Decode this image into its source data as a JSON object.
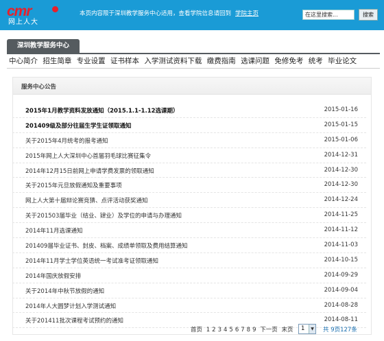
{
  "header": {
    "logo_mark": "cmr",
    "logo_sub": "网上人大",
    "notice": "本页内容限于深圳教学服务中心适用，查看学院信息请回到",
    "notice_link": "学院主页",
    "search_placeholder": "在这里搜索...",
    "search_button": "搜索"
  },
  "center_tab": "深圳教学服务中心",
  "nav": [
    "中心简介",
    "招生简章",
    "专业设置",
    "证书样本",
    "入学测试资料下载",
    "缴费指南",
    "选课问题",
    "免修免考",
    "统考",
    "毕业论文"
  ],
  "panel": {
    "title": "服务中心公告",
    "notices": [
      {
        "title": "2015年1月教学资料发放通知（2015.1.1-1.12选课期）",
        "date": "2015-01-16",
        "bold": true
      },
      {
        "title": "201409级及部分往届生学生证领取通知",
        "date": "2015-01-15",
        "bold": true
      },
      {
        "title": "关于2015年4月统考的报考通知",
        "date": "2015-01-06",
        "bold": false
      },
      {
        "title": "2015年网上人大深圳中心首届羽毛球比赛征集令",
        "date": "2014-12-31",
        "bold": false
      },
      {
        "title": "2014年12月15日前网上申请学费发票的领取通知",
        "date": "2014-12-30",
        "bold": false
      },
      {
        "title": "关于2015年元旦放假通知及重要事项",
        "date": "2014-12-30",
        "bold": false
      },
      {
        "title": "网上人大第十届辩论赛竞猜、点评活动获奖通知",
        "date": "2014-12-24",
        "bold": false
      },
      {
        "title": "关于201503届毕业（结业、肄业）及学位的申请与办理通知",
        "date": "2014-11-25",
        "bold": false
      },
      {
        "title": "2014年11月选课通知",
        "date": "2014-11-12",
        "bold": false
      },
      {
        "title": "201409届毕业证书、封皮、档案、成绩单领取及费用结算通知",
        "date": "2014-11-03",
        "bold": false
      },
      {
        "title": "2014年11月学士学位英语统一考试准考证领取通知",
        "date": "2014-10-15",
        "bold": false
      },
      {
        "title": "2014年国庆放假安排",
        "date": "2014-09-29",
        "bold": false
      },
      {
        "title": "关于2014年中秋节放假的通知",
        "date": "2014-09-04",
        "bold": false
      },
      {
        "title": "2014年人大圆梦计划入学测试通知",
        "date": "2014-08-28",
        "bold": false
      },
      {
        "title": "关于201411批次课程考试预约的通知",
        "date": "2014-08-11",
        "bold": false
      }
    ]
  },
  "pager": {
    "first": "首页",
    "pages": [
      "1",
      "2",
      "3",
      "4",
      "5",
      "6",
      "7",
      "8",
      "9"
    ],
    "next": "下一页",
    "last": "末页",
    "current": "1",
    "total": "共 9页127条"
  },
  "colors": {
    "header_bg": "#1a9bd6",
    "logo_red": "#e8202a",
    "tab_bg": "#555b5f"
  }
}
